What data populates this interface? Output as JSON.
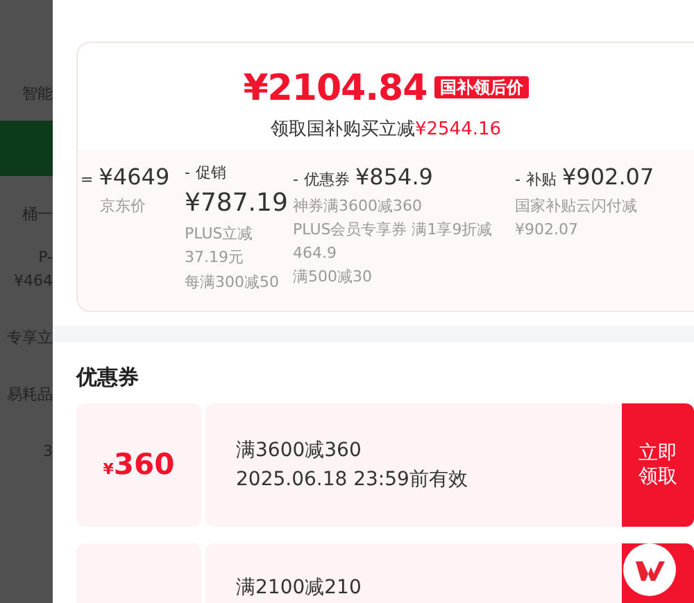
{
  "background_page": {
    "fragments": [
      "智能",
      "桶一",
      "P-",
      "¥464",
      "专享立",
      "易耗品",
      "3"
    ]
  },
  "price_card": {
    "price": "¥2104.84",
    "price_tag": "国补领后价",
    "saving_label": "领取国补购买立减",
    "saving_amount": "¥2544.16",
    "breakdown": [
      {
        "operator": "=",
        "amount": "¥4649",
        "notes": [
          "京东价"
        ]
      },
      {
        "operator": "-",
        "title": "促销",
        "amount": "¥787.19",
        "notes": [
          "PLUS立减37.19元",
          "每满300减50"
        ]
      },
      {
        "operator": "-",
        "title": "优惠券",
        "amount": "¥854.9",
        "notes": [
          "神券满3600减360",
          "PLUS会员专享券 满1享9折减464.9",
          "满500减30"
        ]
      },
      {
        "operator": "-",
        "title": "补贴",
        "amount": "¥902.07",
        "notes": [
          "国家补贴云闪付减¥902.07"
        ]
      }
    ]
  },
  "coupons_section": {
    "title": "优惠券",
    "coupons": [
      {
        "currency": "¥",
        "value": "360",
        "condition": "满3600减360",
        "validity": "2025.06.18 23:59前有效",
        "button": "立即领取"
      },
      {
        "condition": "满2100减210"
      }
    ]
  }
}
